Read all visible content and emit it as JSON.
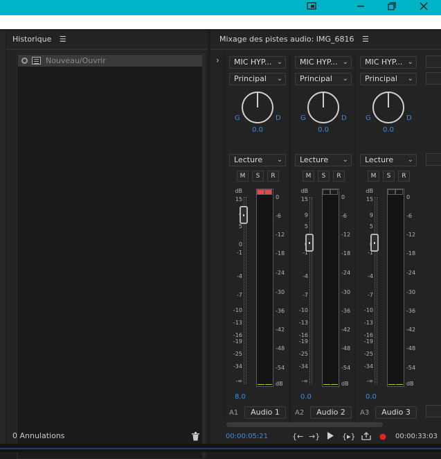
{
  "window": {
    "controls": [
      "restore-icon",
      "maximize-icon",
      "close-icon"
    ],
    "accent": "#00b4c8"
  },
  "history": {
    "title": "Historique",
    "items": [
      {
        "label": "Nouveau/Ouvrir"
      }
    ],
    "footer": "0 Annulations"
  },
  "mixer": {
    "title": "Mixage des pistes audio: IMG_6816",
    "expand_glyph": "›",
    "tracks": [
      {
        "input": "MIC HYP...",
        "output": "Principal",
        "pan_left": "G",
        "pan_right": "D",
        "pan_value": "0.0",
        "automation": "Lecture",
        "mute": "M",
        "solo": "S",
        "record": "R",
        "volume": "8.0",
        "channel": "A1",
        "name": "Audio 1",
        "peak_clipped": true
      },
      {
        "input": "MIC HYP...",
        "output": "Principal",
        "pan_left": "G",
        "pan_right": "D",
        "pan_value": "0.0",
        "automation": "Lecture",
        "mute": "M",
        "solo": "S",
        "record": "R",
        "volume": "0.0",
        "channel": "A2",
        "name": "Audio 2",
        "peak_clipped": false
      },
      {
        "input": "MIC HYP...",
        "output": "Principal",
        "pan_left": "G",
        "pan_right": "D",
        "pan_value": "0.0",
        "automation": "Lecture",
        "mute": "M",
        "solo": "S",
        "record": "R",
        "volume": "0.0",
        "channel": "A3",
        "name": "Audio 3",
        "peak_clipped": false
      }
    ],
    "fader_scale": {
      "unit": "dB",
      "ticks": [
        "15",
        "9",
        "5",
        "0",
        "-1",
        "-4",
        "-7",
        "-10",
        "-13",
        "-16",
        "-19",
        "-25",
        "-34",
        "-∞"
      ]
    },
    "meter_scale": {
      "ticks": [
        "0",
        "-6",
        "-12",
        "-18",
        "-24",
        "-30",
        "-36",
        "-42",
        "-48",
        "-54"
      ],
      "unit": "dB"
    },
    "transport": {
      "current_time": "00:00:05:21",
      "duration": "00:00:33:03"
    }
  }
}
